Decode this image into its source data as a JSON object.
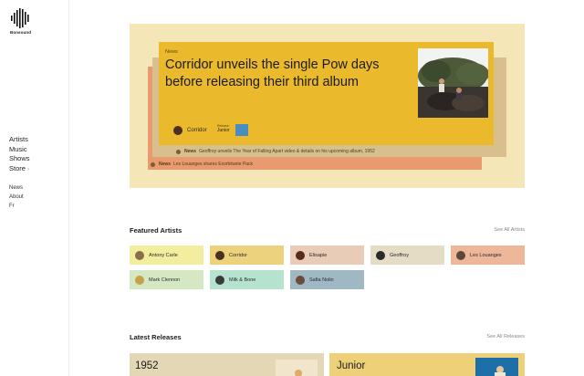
{
  "brand": {
    "name": "Bonsound"
  },
  "nav": {
    "main": [
      "Artists",
      "Music",
      "Shows",
      "Store"
    ],
    "store_chevron": "›",
    "secondary": [
      "News",
      "About",
      "Fr"
    ]
  },
  "hero": {
    "category": "News",
    "title": "Corridor unveils the single Pow days before releasing their third album",
    "artist": "Corridor",
    "release_label": "Release",
    "release_name": "Junior",
    "news": [
      {
        "source": "News",
        "text": "Geoffroy unveils The Year of Falling Apart video & details on his upcoming album, 1952"
      },
      {
        "source": "News",
        "text": "Les Louanges shares Exorbitante Pack"
      }
    ]
  },
  "featured": {
    "title": "Featured Artists",
    "see_all": "See All Artists",
    "artists": [
      {
        "name": "Antony Carle",
        "color": "#f3ee9d",
        "avatar": "#8a6d4f"
      },
      {
        "name": "Corridor",
        "color": "#ecd27c",
        "avatar": "#4a3020"
      },
      {
        "name": "Elisapie",
        "color": "#e8ccb7",
        "avatar": "#5a2a1a"
      },
      {
        "name": "Geoffroy",
        "color": "#e4dcc4",
        "avatar": "#2a2a2a"
      },
      {
        "name": "Les Louanges",
        "color": "#eeb79a",
        "avatar": "#5a4a3a"
      },
      {
        "name": "Mark Clennon",
        "color": "#d4e8c3",
        "avatar": "#c9a04a"
      },
      {
        "name": "Milk & Bone",
        "color": "#b5e3cf",
        "avatar": "#3a3a3a"
      },
      {
        "name": "Safia Nolin",
        "color": "#9fb8c4",
        "avatar": "#6a4a3a"
      }
    ]
  },
  "latest": {
    "title": "Latest Releases",
    "see_all": "See All Releases",
    "releases": [
      {
        "name": "1952",
        "color": "#e3d7b5"
      },
      {
        "name": "Junior",
        "color": "#eed079"
      }
    ]
  }
}
